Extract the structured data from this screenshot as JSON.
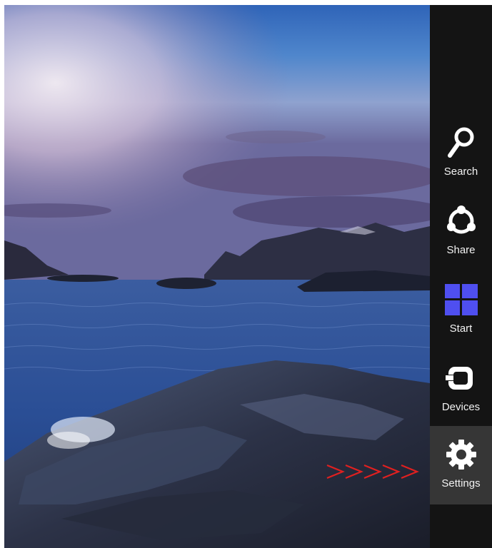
{
  "charms": [
    {
      "label": "Search",
      "icon": "search-icon",
      "active": false
    },
    {
      "label": "Share",
      "icon": "share-icon",
      "active": false
    },
    {
      "label": "Start",
      "icon": "windows-logo-icon",
      "active": false,
      "color": "#4f4ff0"
    },
    {
      "label": "Devices",
      "icon": "devices-icon",
      "active": false
    },
    {
      "label": "Settings",
      "icon": "gear-icon",
      "active": true
    }
  ],
  "colors": {
    "charms_background": "#141414",
    "active_charm_background": "#363636",
    "start_logo": "#4f4ff0",
    "hint_arrows": "#e02020"
  }
}
